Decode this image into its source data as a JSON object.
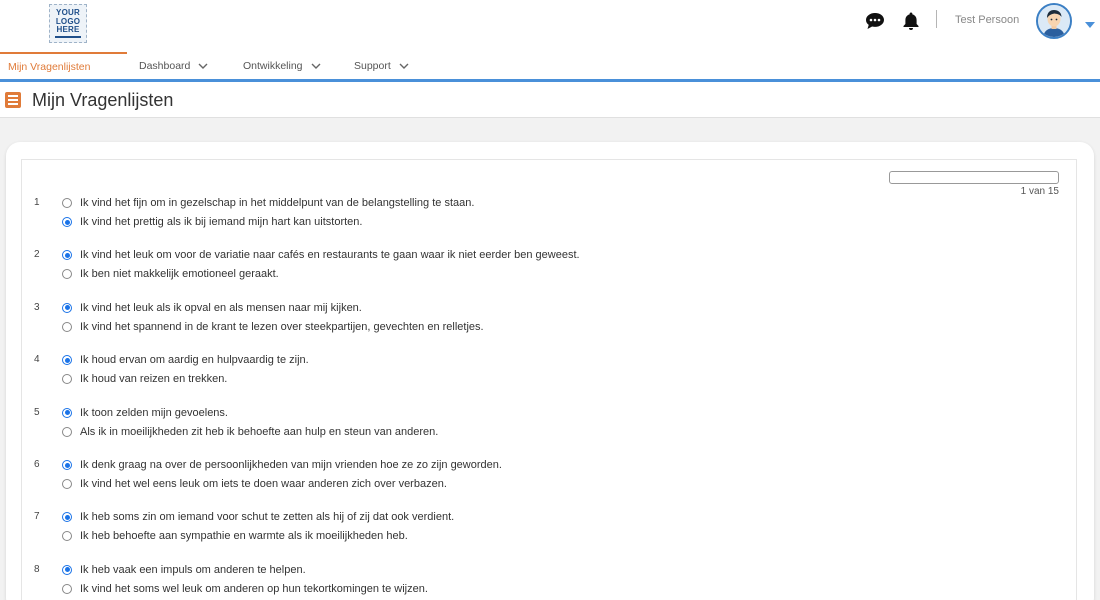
{
  "header": {
    "logo_lines": [
      "YOUR",
      "LOGO",
      "HERE"
    ],
    "user_name": "Test Persoon"
  },
  "nav": {
    "items": [
      {
        "label": "Mijn Vragenlijsten",
        "active": true
      },
      {
        "label": "Dashboard",
        "dropdown": true
      },
      {
        "label": "Ontwikkeling",
        "dropdown": true
      },
      {
        "label": "Support",
        "dropdown": true
      }
    ]
  },
  "page": {
    "title": "Mijn Vragenlijsten"
  },
  "progress": {
    "text": "1 van 15",
    "fraction": 0.0
  },
  "questions": [
    {
      "num": "1",
      "options": [
        {
          "label": "Ik vind het fijn om in gezelschap in het middelpunt van de belangstelling te staan.",
          "checked": false
        },
        {
          "label": "Ik vind het prettig als ik bij iemand mijn hart kan uitstorten.",
          "checked": true
        }
      ]
    },
    {
      "num": "2",
      "options": [
        {
          "label": "Ik vind het leuk om voor de variatie naar cafés en restaurants te gaan waar ik niet eerder ben geweest.",
          "checked": true
        },
        {
          "label": "Ik ben niet makkelijk emotioneel geraakt.",
          "checked": false
        }
      ]
    },
    {
      "num": "3",
      "options": [
        {
          "label": "Ik vind het leuk als ik opval en als mensen naar mij kijken.",
          "checked": true
        },
        {
          "label": "Ik vind het spannend in de krant te lezen over steekpartijen, gevechten en relletjes.",
          "checked": false
        }
      ]
    },
    {
      "num": "4",
      "options": [
        {
          "label": "Ik houd ervan om aardig en hulpvaardig te zijn.",
          "checked": true
        },
        {
          "label": "Ik houd van reizen en trekken.",
          "checked": false
        }
      ]
    },
    {
      "num": "5",
      "options": [
        {
          "label": "Ik toon zelden mijn gevoelens.",
          "checked": true
        },
        {
          "label": "Als ik in moeilijkheden zit heb ik behoefte aan hulp en steun van anderen.",
          "checked": false
        }
      ]
    },
    {
      "num": "6",
      "options": [
        {
          "label": "Ik denk graag na over de persoonlijkheden van mijn vrienden hoe ze zo zijn geworden.",
          "checked": true
        },
        {
          "label": "Ik vind het wel eens leuk om iets te doen waar anderen zich over verbazen.",
          "checked": false
        }
      ]
    },
    {
      "num": "7",
      "options": [
        {
          "label": "Ik heb soms zin om iemand voor schut te zetten als hij of zij dat ook verdient.",
          "checked": true
        },
        {
          "label": "Ik heb behoefte aan sympathie en warmte als ik moeilijkheden heb.",
          "checked": false
        }
      ]
    },
    {
      "num": "8",
      "options": [
        {
          "label": "Ik heb vaak een impuls om anderen te helpen.",
          "checked": true
        },
        {
          "label": "Ik vind het soms wel leuk om anderen op hun tekortkomingen te wijzen.",
          "checked": false
        }
      ]
    }
  ]
}
